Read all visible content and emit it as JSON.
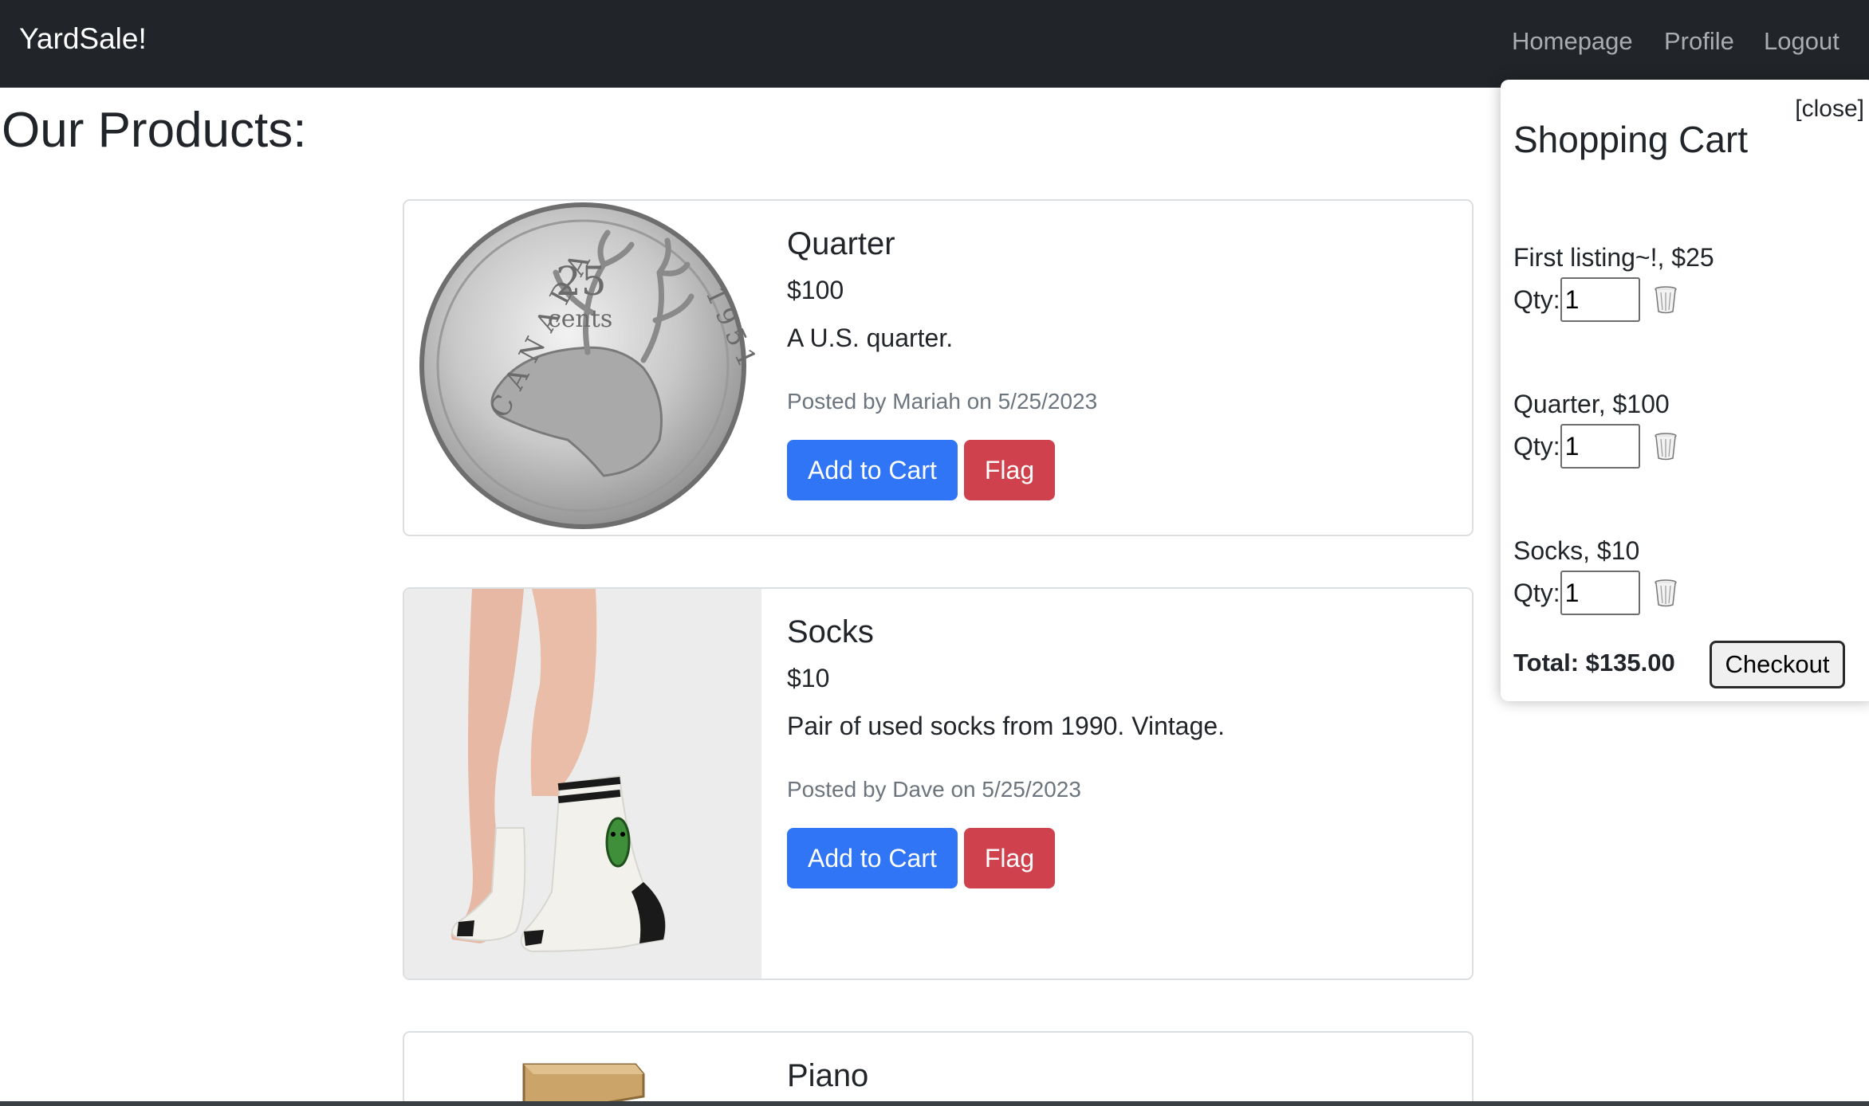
{
  "navbar": {
    "brand": "YardSale!",
    "links": [
      "Homepage",
      "Profile",
      "Logout"
    ]
  },
  "page": {
    "title": "Our Products:"
  },
  "products": [
    {
      "name": "Quarter",
      "price": "$100",
      "description": "A U.S. quarter.",
      "meta": "Posted by Mariah on 5/25/2023",
      "add_label": "Add to Cart",
      "flag_label": "Flag",
      "image": "canada-25-cents-coin",
      "coin_text": {
        "country": "CANADA",
        "value": "25",
        "unit": "cents",
        "year": "1951"
      }
    },
    {
      "name": "Socks",
      "price": "$10",
      "description": "Pair of used socks from 1990. Vintage.",
      "meta": "Posted by Dave on 5/25/2023",
      "add_label": "Add to Cart",
      "flag_label": "Flag",
      "image": "pickle-socks-photo"
    },
    {
      "name": "Piano",
      "image": "piano-photo"
    }
  ],
  "cart": {
    "close_label": "[close]",
    "title": "Shopping Cart",
    "qty_label": "Qty:",
    "items": [
      {
        "label": "First listing~!, $25",
        "qty": "1"
      },
      {
        "label": "Quarter, $100",
        "qty": "1"
      },
      {
        "label": "Socks, $10",
        "qty": "1"
      }
    ],
    "total": "Total: $135.00",
    "checkout_label": "Checkout"
  },
  "colors": {
    "navbar_bg": "#212529",
    "primary": "#2f75f6",
    "danger": "#d0414e",
    "muted": "#6c757d"
  }
}
